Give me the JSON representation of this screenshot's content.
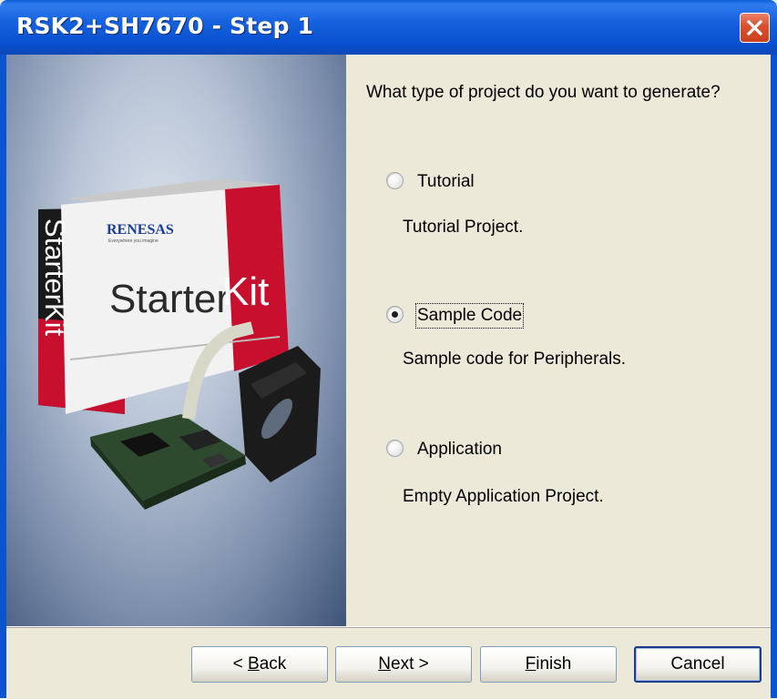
{
  "window": {
    "title": "RSK2+SH7670 - Step 1"
  },
  "image_panel": {
    "brand": "RENESAS",
    "tagline": "Everywhere you imagine",
    "product_main": "Starter",
    "product_accent": "Kit",
    "box_side_text": "StarterKit"
  },
  "wizard": {
    "question": "What type of project do you want to generate?",
    "selected": "Sample Code",
    "options": [
      {
        "label": "Tutorial",
        "description": "Tutorial Project."
      },
      {
        "label": "Sample Code",
        "description": "Sample code for Peripherals."
      },
      {
        "label": "Application",
        "description": "Empty Application Project."
      }
    ]
  },
  "buttons": {
    "back": {
      "mnemonic": "B",
      "rest": "ack",
      "prefix": "< "
    },
    "next": {
      "mnemonic": "N",
      "rest": "ext >"
    },
    "finish": {
      "mnemonic": "F",
      "rest": "inish"
    },
    "cancel": {
      "label": "Cancel"
    }
  },
  "colors": {
    "title_bar": "#0A5FD8",
    "dialog_bg": "#ECE9D8",
    "close_button": "#D8502F",
    "renesas_red": "#C8102E"
  }
}
